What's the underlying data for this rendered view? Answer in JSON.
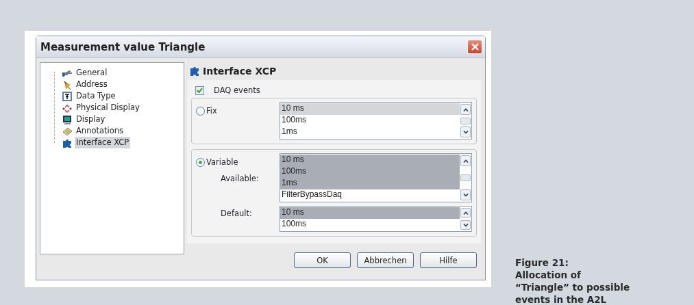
{
  "window": {
    "title": "Measurement value Triangle"
  },
  "tree": {
    "items": [
      {
        "label": "General",
        "selected": false
      },
      {
        "label": "Address",
        "selected": false
      },
      {
        "label": "Data Type",
        "selected": false
      },
      {
        "label": "Physical Display",
        "selected": false
      },
      {
        "label": "Display",
        "selected": false
      },
      {
        "label": "Annotations",
        "selected": false
      },
      {
        "label": "Interface XCP",
        "selected": true
      }
    ]
  },
  "panel": {
    "title": "Interface XCP",
    "daq_events": {
      "label": "DAQ events",
      "checked": true
    },
    "groups": [
      {
        "radio": {
          "label": "Fix",
          "selected": false
        },
        "lists": [
          {
            "kind": "full",
            "items": [
              {
                "text": "10 ms",
                "selected": true
              },
              {
                "text": "100ms",
                "selected": false
              },
              {
                "text": "1ms",
                "selected": false
              }
            ]
          }
        ]
      },
      {
        "radio": {
          "label": "Variable",
          "selected": true
        },
        "lists": [
          {
            "kind": "full",
            "label": "Available:",
            "items": [
              {
                "text": "10 ms",
                "selected": true
              },
              {
                "text": "100ms",
                "selected": true
              },
              {
                "text": "1ms",
                "selected": true
              },
              {
                "text": "FilterBypassDaq",
                "selected": false
              }
            ]
          },
          {
            "kind": "small",
            "label": "Default:",
            "items": [
              {
                "text": "10 ms",
                "selected": true
              },
              {
                "text": "100ms",
                "selected": false
              }
            ]
          }
        ]
      }
    ]
  },
  "buttons": [
    "OK",
    "Abbrechen",
    "Hilfe"
  ],
  "caption": [
    "Figure 21:",
    "Allocation of",
    "“Triangle” to possible",
    "events in the A2L"
  ]
}
